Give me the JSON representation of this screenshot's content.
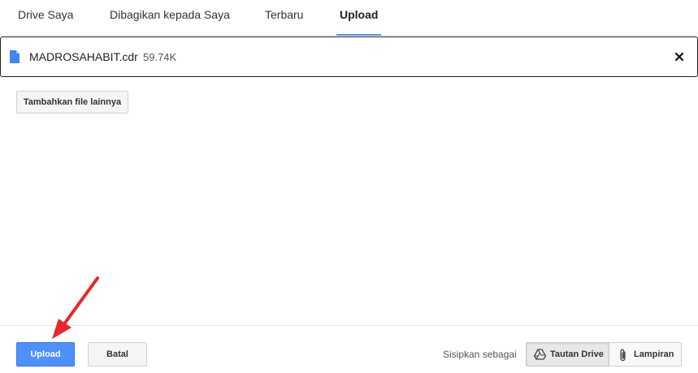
{
  "tabs": [
    {
      "label": "Drive Saya",
      "active": false
    },
    {
      "label": "Dibagikan kepada Saya",
      "active": false
    },
    {
      "label": "Terbaru",
      "active": false
    },
    {
      "label": "Upload",
      "active": true
    }
  ],
  "file": {
    "name": "MADROSAHABIT.cdr",
    "size": "59.74K",
    "icon": "file-icon",
    "icon_color": "#4285f4"
  },
  "add_more_label": "Tambahkan file lainnya",
  "footer": {
    "upload_label": "Upload",
    "cancel_label": "Batal",
    "insert_as_label": "Sisipkan sebagai",
    "drive_link_label": "Tautan Drive",
    "attachment_label": "Lampiran",
    "selected": "Tautan Drive"
  },
  "colors": {
    "accent": "#4d90fe",
    "annotation": "#e8262b"
  }
}
